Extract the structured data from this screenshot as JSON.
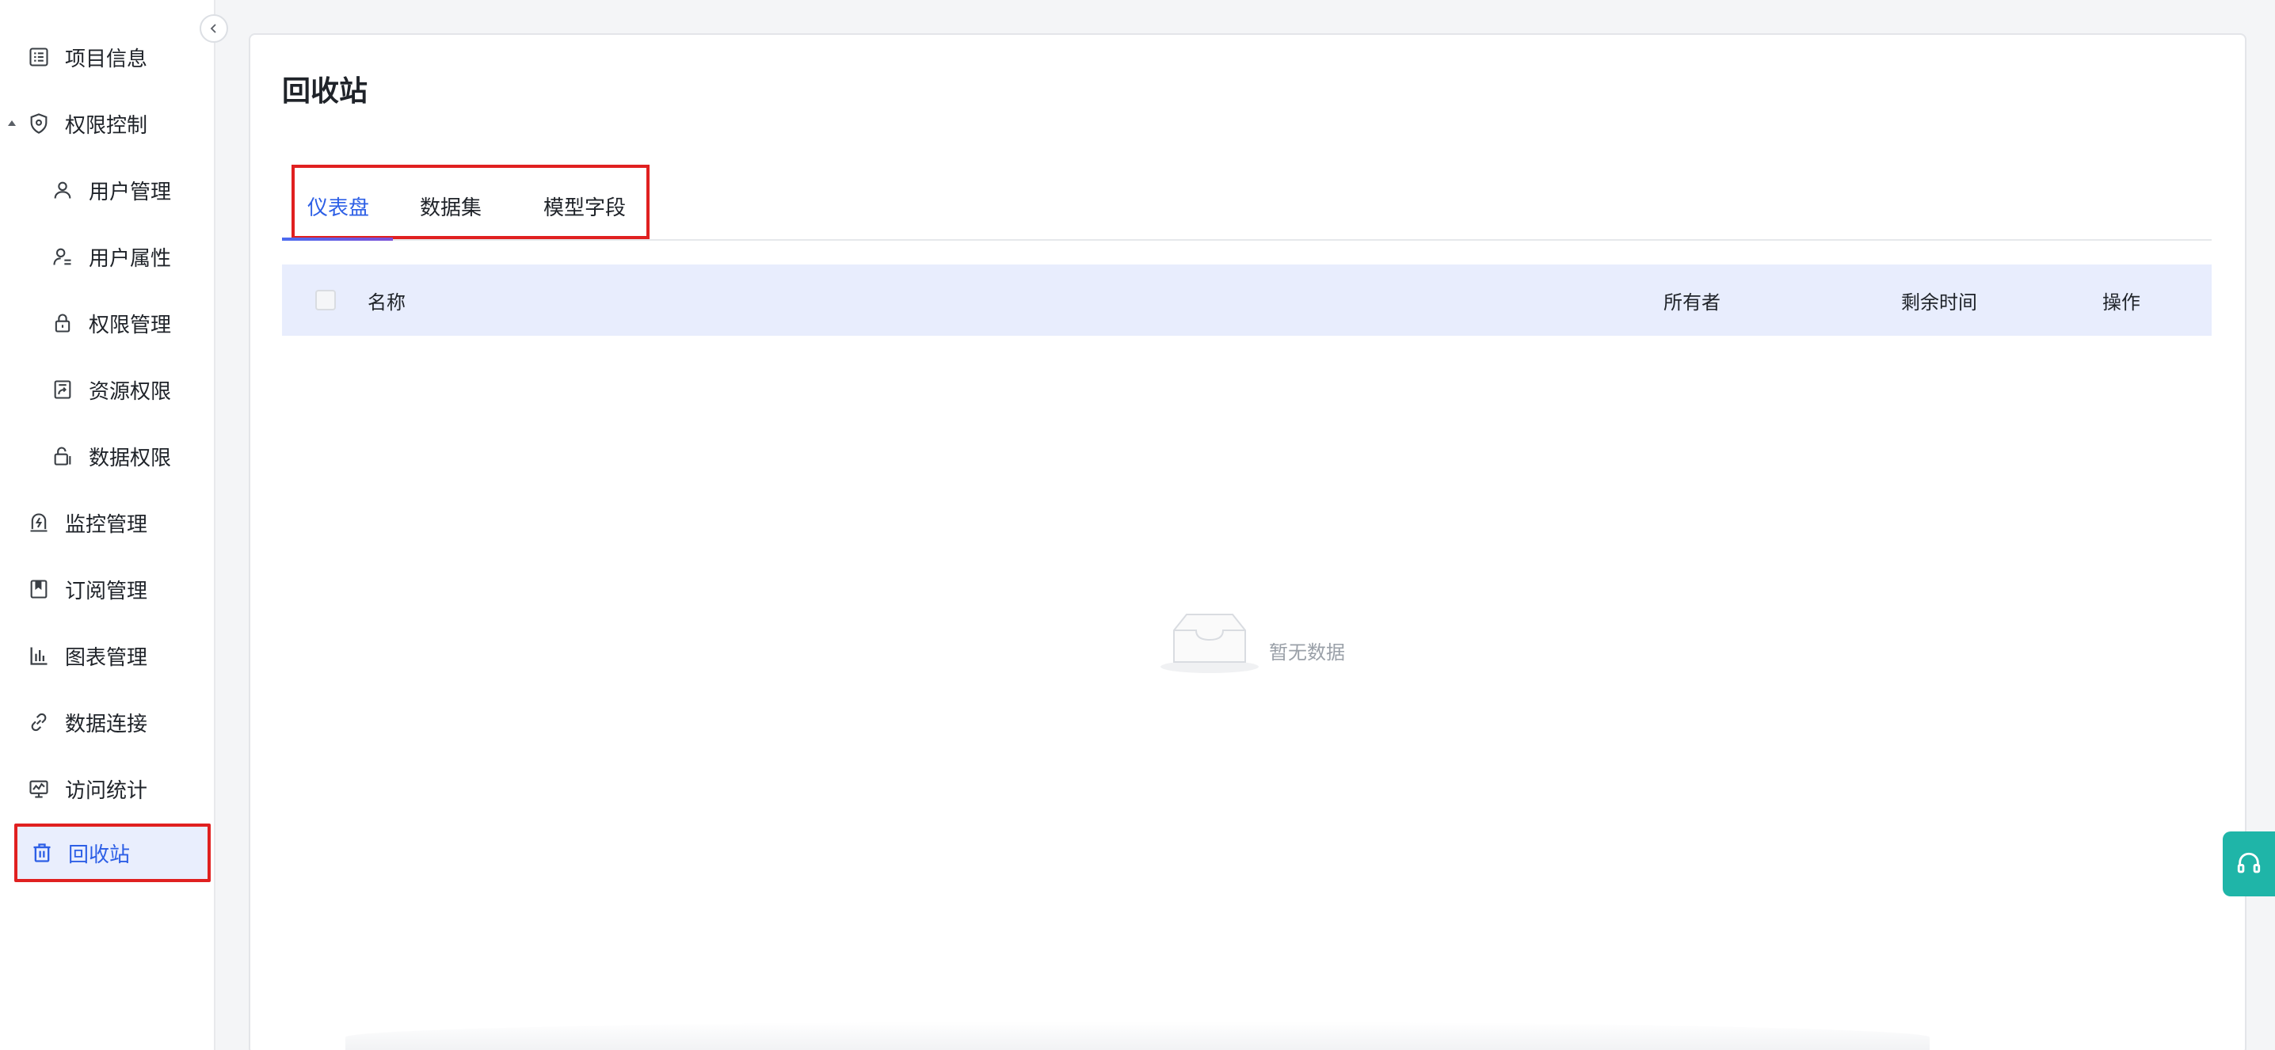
{
  "sidebar": {
    "items": [
      {
        "label": "项目信息",
        "icon": "list-icon"
      },
      {
        "label": "权限控制",
        "icon": "shield-icon"
      },
      {
        "label": "用户管理",
        "icon": "user-icon"
      },
      {
        "label": "用户属性",
        "icon": "user-attribute-icon"
      },
      {
        "label": "权限管理",
        "icon": "lock-icon"
      },
      {
        "label": "资源权限",
        "icon": "resource-share-icon"
      },
      {
        "label": "数据权限",
        "icon": "data-lock-icon"
      },
      {
        "label": "监控管理",
        "icon": "monitor-icon"
      },
      {
        "label": "订阅管理",
        "icon": "bookmark-icon"
      },
      {
        "label": "图表管理",
        "icon": "bar-chart-icon"
      },
      {
        "label": "数据连接",
        "icon": "link-icon"
      },
      {
        "label": "访问统计",
        "icon": "screen-stats-icon"
      },
      {
        "label": "回收站",
        "icon": "trash-icon"
      }
    ]
  },
  "main": {
    "title": "回收站",
    "tabs": [
      {
        "label": "仪表盘"
      },
      {
        "label": "数据集"
      },
      {
        "label": "模型字段"
      }
    ],
    "table": {
      "columns": [
        "名称",
        "所有者",
        "剩余时间",
        "操作"
      ]
    },
    "empty_text": "暂无数据"
  },
  "colors": {
    "accent": "#2d5fe6",
    "highlight_border": "#e02020",
    "table_header_bg": "#e8edfd",
    "support_button": "#1fb5a8"
  }
}
